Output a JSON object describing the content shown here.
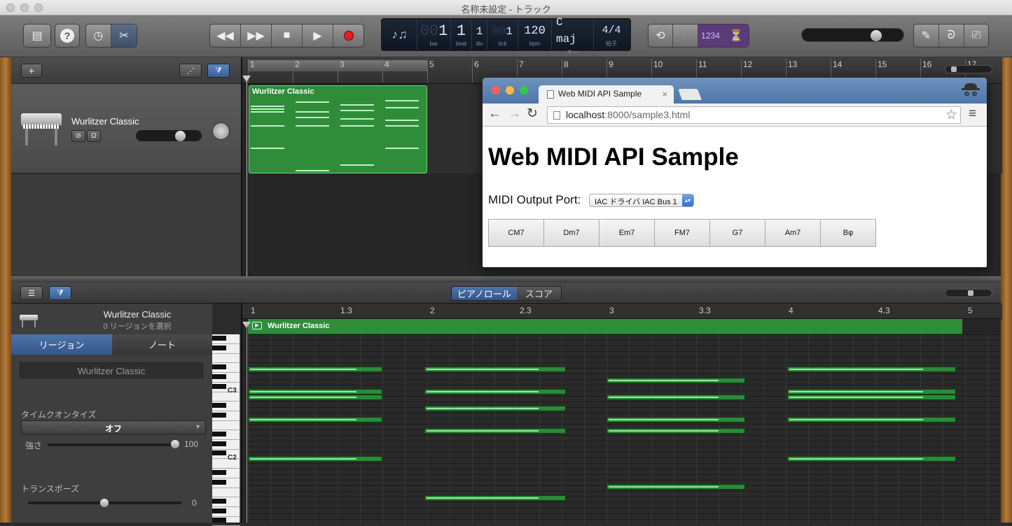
{
  "window": {
    "title": "名称未設定 - トラック"
  },
  "lcd": {
    "bar": "1",
    "bar_label": "bar",
    "beat": "1",
    "beat_label": "beat",
    "div": "1",
    "div_label": "div",
    "tick": "1",
    "tick_label": "tick",
    "tempo": "120",
    "tempo_label": "bpm",
    "key": "C maj",
    "key_label": "キー",
    "signature": "4/4",
    "signature_label": "拍子"
  },
  "count_in": "1234",
  "tracks": {
    "add_label": "+",
    "track1": {
      "name": "Wurlitzer Classic"
    }
  },
  "arrange": {
    "ruler": [
      "1",
      "2",
      "3",
      "4",
      "5",
      "6",
      "7",
      "8",
      "9",
      "10",
      "11",
      "12",
      "13",
      "14",
      "15",
      "16",
      "17"
    ],
    "region_name": "Wurlitzer Classic"
  },
  "editor": {
    "tabs": [
      "ピアノロール",
      "スコア"
    ],
    "active_tab": 0,
    "track_name": "Wurlitzer Classic",
    "selection_info": "0 リージョンを選択",
    "inspector_tabs": [
      "リージョン",
      "ノート"
    ],
    "region_field": "Wurlitzer Classic",
    "quantize_label": "タイムクオンタイズ",
    "quantize_value": "オフ",
    "strength_label": "強さ",
    "strength_value": "100",
    "transpose_label": "トランスポーズ",
    "transpose_value": "0",
    "key_labels": {
      "c3": "C3",
      "c2": "C2"
    },
    "ruler": [
      "1",
      "1.3",
      "2",
      "2.3",
      "3",
      "3.3",
      "4",
      "4.3",
      "5"
    ],
    "region_name": "Wurlitzer Classic"
  },
  "browser": {
    "tab_title": "Web MIDI API Sample",
    "url_host": "localhost",
    "url_rest": ":8000/sample3.html",
    "heading": "Web MIDI API Sample",
    "port_label": "MIDI Output Port:",
    "port_value": "IAC ドライバ IAC Bus 1",
    "chords": [
      "CM7",
      "Dm7",
      "Em7",
      "FM7",
      "G7",
      "Am7",
      "Bφ"
    ]
  },
  "colors": {
    "region_green": "#2f8d3a",
    "lcd_bg": "#0e1622",
    "browser_tab_blue": "#4f76a8"
  }
}
